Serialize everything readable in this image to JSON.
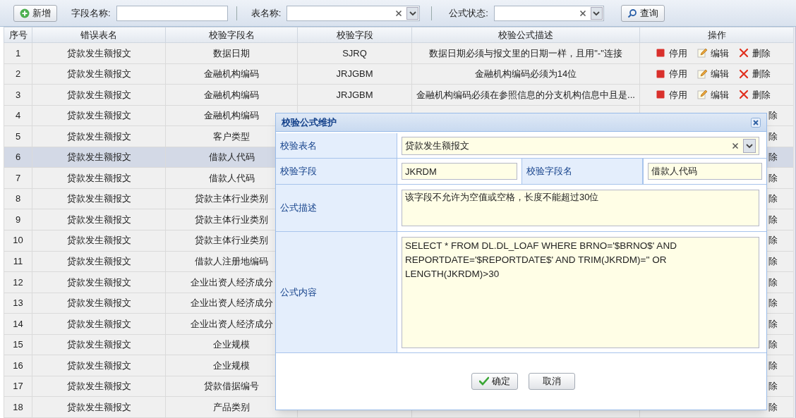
{
  "toolbar": {
    "add_button": "新增",
    "field_name_filter": {
      "label": "字段名称:"
    },
    "table_name_filter": {
      "label": "表名称:"
    },
    "status_filter": {
      "label": "公式状态:"
    },
    "query_button": "查询"
  },
  "table": {
    "columns": [
      "序号",
      "错误表名",
      "校验字段名",
      "校验字段",
      "校验公式描述",
      "操作"
    ],
    "rows": [
      {
        "seq": "1",
        "table": "贷款发生额报文",
        "field_name": "数据日期",
        "field": "SJRQ",
        "description": "数据日期必须与报文里的日期一样，且用\"-\"连接",
        "actions": [
          "停用",
          "编辑",
          "删除"
        ],
        "selected": false
      },
      {
        "seq": "2",
        "table": "贷款发生额报文",
        "field_name": "金融机构编码",
        "field": "JRJGBM",
        "description": "金融机构编码必须为14位",
        "actions": [
          "停用",
          "编辑",
          "删除"
        ],
        "selected": false
      },
      {
        "seq": "3",
        "table": "贷款发生额报文",
        "field_name": "金融机构编码",
        "field": "JRJGBM",
        "description": "金融机构编码必须在参照信息的分支机构信息中且是...",
        "actions": [
          "停用",
          "编辑",
          "删除"
        ],
        "selected": false
      },
      {
        "seq": "4",
        "table": "贷款发生额报文",
        "field_name": "金融机构编码",
        "actions_tail": "除",
        "selected": false
      },
      {
        "seq": "5",
        "table": "贷款发生额报文",
        "field_name": "客户类型",
        "actions_tail": "除",
        "selected": false
      },
      {
        "seq": "6",
        "table": "贷款发生额报文",
        "field_name": "借款人代码",
        "actions_tail": "除",
        "selected": true
      },
      {
        "seq": "7",
        "table": "贷款发生额报文",
        "field_name": "借款人代码",
        "actions_tail": "除",
        "selected": false
      },
      {
        "seq": "8",
        "table": "贷款发生额报文",
        "field_name": "贷款主体行业类别",
        "actions_tail": "除",
        "selected": false
      },
      {
        "seq": "9",
        "table": "贷款发生额报文",
        "field_name": "贷款主体行业类别",
        "actions_tail": "除",
        "selected": false
      },
      {
        "seq": "10",
        "table": "贷款发生额报文",
        "field_name": "贷款主体行业类别",
        "actions_tail": "除",
        "selected": false
      },
      {
        "seq": "11",
        "table": "贷款发生额报文",
        "field_name": "借款人注册地编码",
        "actions_tail": "除",
        "selected": false
      },
      {
        "seq": "12",
        "table": "贷款发生额报文",
        "field_name": "企业出资人经济成分",
        "actions_tail": "除",
        "selected": false
      },
      {
        "seq": "13",
        "table": "贷款发生额报文",
        "field_name": "企业出资人经济成分",
        "actions_tail": "除",
        "selected": false
      },
      {
        "seq": "14",
        "table": "贷款发生额报文",
        "field_name": "企业出资人经济成分",
        "actions_tail": "除",
        "selected": false
      },
      {
        "seq": "15",
        "table": "贷款发生额报文",
        "field_name": "企业规模",
        "actions_tail": "除",
        "selected": false
      },
      {
        "seq": "16",
        "table": "贷款发生额报文",
        "field_name": "企业规模",
        "actions_tail": "除",
        "selected": false
      },
      {
        "seq": "17",
        "table": "贷款发生额报文",
        "field_name": "贷款借据编号",
        "actions_tail": "除",
        "selected": false
      },
      {
        "seq": "18",
        "table": "贷款发生额报文",
        "field_name": "产品类别",
        "actions_tail": "除",
        "selected": false
      }
    ]
  },
  "dialog": {
    "title": "校验公式维护",
    "table_name": {
      "label": "校验表名",
      "value": "贷款发生额报文"
    },
    "field": {
      "label": "校验字段",
      "value": "JKRDM"
    },
    "field_name": {
      "label": "校验字段名",
      "value": "借款人代码"
    },
    "description": {
      "label": "公式描述",
      "value": "该字段不允许为空值或空格，长度不能超过30位"
    },
    "content": {
      "label": "公式内容",
      "value": "SELECT * FROM DL.DL_LOAF WHERE BRNO='$BRNO$' AND REPORTDATE='$REPORTDATE$' AND TRIM(JKRDM)='' OR LENGTH(JKRDM)>30"
    },
    "buttons": [
      {
        "kind": "ok",
        "label": "确定"
      },
      {
        "kind": "cancel",
        "label": "取消"
      }
    ]
  }
}
